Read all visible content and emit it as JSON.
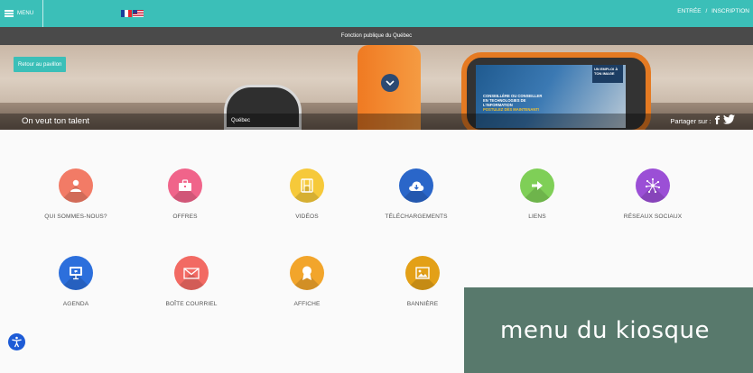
{
  "topbar": {
    "menu_label": "MENU",
    "auth_login": "ENTRÉE",
    "auth_sep": "/",
    "auth_register": "INSCRIPTION",
    "color": "#3bbfb8"
  },
  "subbar": {
    "title": "Fonction publique du Québec"
  },
  "hero": {
    "back_button": "Retour au pavillon",
    "caption": "On veut ton talent",
    "share_label": "Partager sur :",
    "screen_line1": "CONSEILLÈRE OU CONSEILLER",
    "screen_line2": "EN TECHNOLOGIES DE L'INFORMATION",
    "screen_line3": "POSTULEZ DÈS MAINTENANT!",
    "screen_badge": "UN EMPLOI À TON IMAGE",
    "booth_label": "Québec"
  },
  "menu_items": [
    {
      "label": "QUI SOMMES-NOUS?",
      "icon": "person-icon",
      "color": "#f27b66"
    },
    {
      "label": "OFFRES",
      "icon": "briefcase-icon",
      "color": "#f0648a"
    },
    {
      "label": "VIDÉOS",
      "icon": "film-icon",
      "color": "#f6c93a"
    },
    {
      "label": "TÉLÉCHARGEMENTS",
      "icon": "cloud-download-icon",
      "color": "#2a66c9"
    },
    {
      "label": "LIENS",
      "icon": "arrow-right-icon",
      "color": "#7fcf57"
    },
    {
      "label": "RÉSEAUX SOCIAUX",
      "icon": "network-icon",
      "color": "#9b4fd6"
    },
    {
      "label": "AGENDA",
      "icon": "presentation-icon",
      "color": "#2c6fdc"
    },
    {
      "label": "BOÎTE COURRIEL",
      "icon": "envelope-icon",
      "color": "#f26a63"
    },
    {
      "label": "AFFICHE",
      "icon": "award-icon",
      "color": "#f2a52b"
    },
    {
      "label": "BANNIÈRE",
      "icon": "image-icon",
      "color": "#e3a017"
    }
  ],
  "overlay": {
    "text": "menu du kiosque"
  }
}
